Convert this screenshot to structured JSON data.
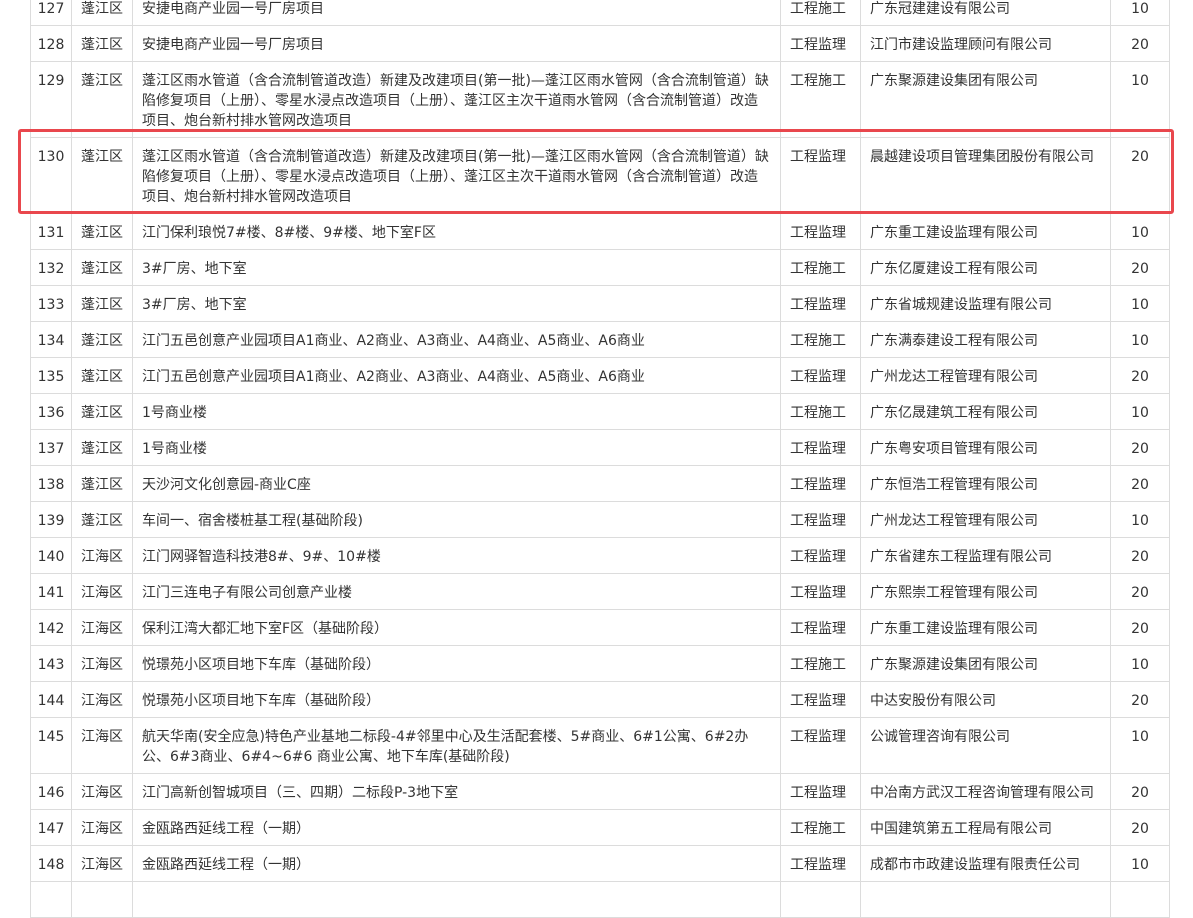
{
  "table": {
    "rows": [
      {
        "no": "127",
        "district": "蓬江区",
        "project": "安捷电商产业园一号厂房项目",
        "type": "工程施工",
        "company": "广东冠建建设有限公司",
        "score": "10"
      },
      {
        "no": "128",
        "district": "蓬江区",
        "project": "安捷电商产业园一号厂房项目",
        "type": "工程监理",
        "company": "江门市建设监理顾问有限公司",
        "score": "20"
      },
      {
        "no": "129",
        "district": "蓬江区",
        "project": "蓬江区雨水管道（含合流制管道改造）新建及改建项目(第一批)—蓬江区雨水管网（含合流制管道）缺陷修复项目（上册）、零星水浸点改造项目（上册）、蓬江区主次干道雨水管网（含合流制管道）改造项目、炮台新村排水管网改造项目",
        "type": "工程施工",
        "company": "广东聚源建设集团有限公司",
        "score": "10"
      },
      {
        "no": "130",
        "district": "蓬江区",
        "project": "蓬江区雨水管道（含合流制管道改造）新建及改建项目(第一批)—蓬江区雨水管网（含合流制管道）缺陷修复项目（上册）、零星水浸点改造项目（上册）、蓬江区主次干道雨水管网（含合流制管道）改造项目、炮台新村排水管网改造项目",
        "type": "工程监理",
        "company": "晨越建设项目管理集团股份有限公司",
        "score": "20"
      },
      {
        "no": "131",
        "district": "蓬江区",
        "project": "江门保利琅悦7#楼、8#楼、9#楼、地下室F区",
        "type": "工程监理",
        "company": "广东重工建设监理有限公司",
        "score": "10"
      },
      {
        "no": "132",
        "district": "蓬江区",
        "project": "3#厂房、地下室",
        "type": "工程施工",
        "company": "广东亿厦建设工程有限公司",
        "score": "20"
      },
      {
        "no": "133",
        "district": "蓬江区",
        "project": "3#厂房、地下室",
        "type": "工程监理",
        "company": "广东省城规建设监理有限公司",
        "score": "10"
      },
      {
        "no": "134",
        "district": "蓬江区",
        "project": "江门五邑创意产业园项目A1商业、A2商业、A3商业、A4商业、A5商业、A6商业",
        "type": "工程施工",
        "company": "广东满泰建设工程有限公司",
        "score": "10"
      },
      {
        "no": "135",
        "district": "蓬江区",
        "project": "江门五邑创意产业园项目A1商业、A2商业、A3商业、A4商业、A5商业、A6商业",
        "type": "工程监理",
        "company": "广州龙达工程管理有限公司",
        "score": "20"
      },
      {
        "no": "136",
        "district": "蓬江区",
        "project": "1号商业楼",
        "type": "工程施工",
        "company": "广东亿晟建筑工程有限公司",
        "score": "10"
      },
      {
        "no": "137",
        "district": "蓬江区",
        "project": "1号商业楼",
        "type": "工程监理",
        "company": "广东粤安项目管理有限公司",
        "score": "20"
      },
      {
        "no": "138",
        "district": "蓬江区",
        "project": "天沙河文化创意园-商业C座",
        "type": "工程监理",
        "company": "广东恒浩工程管理有限公司",
        "score": "20"
      },
      {
        "no": "139",
        "district": "蓬江区",
        "project": "车间一、宿舍楼桩基工程(基础阶段)",
        "type": "工程监理",
        "company": "广州龙达工程管理有限公司",
        "score": "10"
      },
      {
        "no": "140",
        "district": "江海区",
        "project": "江门网驿智造科技港8#、9#、10#楼",
        "type": "工程监理",
        "company": "广东省建东工程监理有限公司",
        "score": "20"
      },
      {
        "no": "141",
        "district": "江海区",
        "project": "江门三连电子有限公司创意产业楼",
        "type": "工程监理",
        "company": "广东熙崇工程管理有限公司",
        "score": "20"
      },
      {
        "no": "142",
        "district": "江海区",
        "project": "保利江湾大都汇地下室F区（基础阶段）",
        "type": "工程监理",
        "company": "广东重工建设监理有限公司",
        "score": "20"
      },
      {
        "no": "143",
        "district": "江海区",
        "project": "悦璟苑小区项目地下车库（基础阶段）",
        "type": "工程施工",
        "company": "广东聚源建设集团有限公司",
        "score": "10"
      },
      {
        "no": "144",
        "district": "江海区",
        "project": "悦璟苑小区项目地下车库（基础阶段）",
        "type": "工程监理",
        "company": "中达安股份有限公司",
        "score": "20"
      },
      {
        "no": "145",
        "district": "江海区",
        "project": "航天华南(安全应急)特色产业基地二标段-4#邻里中心及生活配套楼、5#商业、6#1公寓、6#2办公、6#3商业、6#4~6#6 商业公寓、地下车库(基础阶段)",
        "type": "工程监理",
        "company": "公诚管理咨询有限公司",
        "score": "10"
      },
      {
        "no": "146",
        "district": "江海区",
        "project": "江门高新创智城项目（三、四期）二标段P-3地下室",
        "type": "工程监理",
        "company": "中冶南方武汉工程咨询管理有限公司",
        "score": "20"
      },
      {
        "no": "147",
        "district": "江海区",
        "project": "金瓯路西延线工程（一期）",
        "type": "工程施工",
        "company": "中国建筑第五工程局有限公司",
        "score": "20"
      },
      {
        "no": "148",
        "district": "江海区",
        "project": "金瓯路西延线工程（一期）",
        "type": "工程监理",
        "company": "成都市市政建设监理有限责任公司",
        "score": "10"
      },
      {
        "no": "",
        "district": "",
        "project": "",
        "type": "",
        "company": "",
        "score": ""
      }
    ],
    "highlighted_row": "130",
    "highlight_color": "#e9474d",
    "border_color": "#dcdcdc"
  }
}
